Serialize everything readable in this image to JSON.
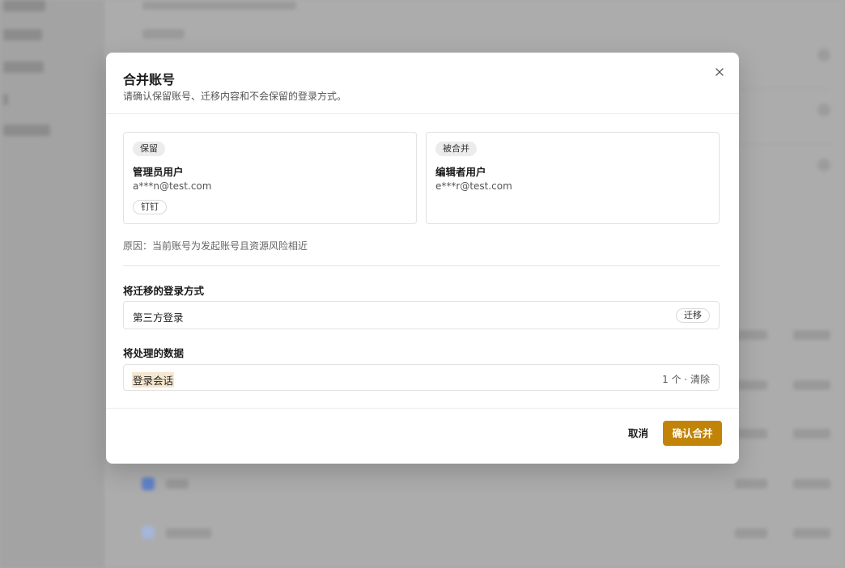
{
  "dialog": {
    "title": "合并账号",
    "subtitle": "请确认保留账号、迁移内容和不会保留的登录方式。",
    "close_icon": "close-icon",
    "keep_account": {
      "badge": "保留",
      "name": "管理员用户",
      "email": "a***n@test.com",
      "login_method": "钉钉"
    },
    "merged_account": {
      "badge": "被合并",
      "name": "编辑者用户",
      "email": "e***r@test.com"
    },
    "reason": "原因：当前账号为发起账号且资源风险相近",
    "migrate_section": {
      "title": "将迁移的登录方式",
      "rows": [
        {
          "label": "第三方登录",
          "action": "迁移"
        }
      ]
    },
    "data_section": {
      "title": "将处理的数据",
      "rows": [
        {
          "label": "登录会话",
          "meta": "1 个 · 清除"
        }
      ]
    },
    "cancel_label": "取消",
    "confirm_label": "确认合并",
    "accent_color": "#c18409"
  }
}
